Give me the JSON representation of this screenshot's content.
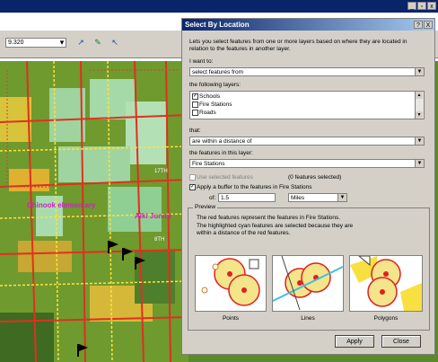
{
  "app": {
    "window_buttons": [
      "_",
      "▫",
      "x"
    ],
    "scale_value": "9.320",
    "toolbar_icons": [
      "select-arrow-icon",
      "identify-icon",
      "help-pointer-icon"
    ]
  },
  "map": {
    "labels": {
      "school_1": "Chinook elementary",
      "school_2": "Alki Junior",
      "street_1": "17TH",
      "street_2": "8TH"
    }
  },
  "dialog": {
    "title": "Select By Location",
    "title_buttons": [
      "?",
      "X"
    ],
    "intro": "Lets you select features from one or more layers based on where they are located in relation to the features in another layer.",
    "want_label": "I want to:",
    "want_value": "select features from",
    "layers_label": "the following layers:",
    "layers": [
      {
        "name": "Schools",
        "checked": true
      },
      {
        "name": "Fire Stations",
        "checked": false
      },
      {
        "name": "Roads",
        "checked": false
      }
    ],
    "that_label": "that:",
    "that_value": "are within a distance of",
    "features_label": "the features in this layer:",
    "features_value": "Fire Stations",
    "use_selected_label": "Use selected features",
    "selected_count": "(0 features selected)",
    "buffer_label": "Apply a buffer to the features in  Fire Stations",
    "of_label": "of:",
    "buffer_value": "1.5",
    "units_value": "Miles",
    "preview": {
      "label": "Preview",
      "text_1": "The red features represent the features in Fire Stations.",
      "text_2": "The highlighted cyan features are selected because they are within a distance of the red features.",
      "captions": [
        "Points",
        "Lines",
        "Polygons"
      ]
    },
    "apply_label": "Apply",
    "close_label": "Close"
  }
}
